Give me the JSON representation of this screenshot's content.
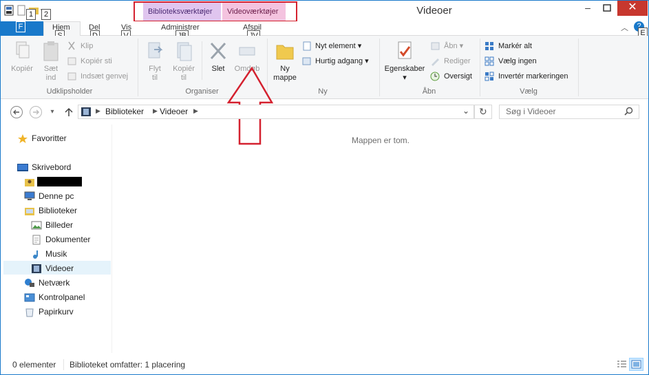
{
  "window": {
    "title": "Videoer"
  },
  "quick_access": {
    "keytip_1": "1",
    "keytip_2": "2"
  },
  "context_tabs": {
    "library_tools": "Biblioteksværktøjer",
    "video_tools": "Videoværktøjer"
  },
  "tabs": {
    "file_keytip": "F",
    "home": "Hjem",
    "home_keytip": "S",
    "share": "Del",
    "share_keytip": "D",
    "view": "Vis",
    "view_keytip": "V",
    "manage": "Administrer",
    "manage_keytip": "JB",
    "play": "Afspil",
    "play_keytip": "JV",
    "help_keytip": "E"
  },
  "ribbon": {
    "clipboard": {
      "label": "Udklipsholder",
      "copy": "Kopiér",
      "paste_1": "Sæt",
      "paste_2": "ind",
      "cut": "Klip",
      "copy_path": "Kopiér sti",
      "paste_shortcut": "Indsæt genvej"
    },
    "organize": {
      "label": "Organiser",
      "move_1": "Flyt",
      "move_2": "til",
      "copy_1": "Kopiér",
      "copy_2": "til",
      "delete": "Slet",
      "rename": "Omdøb"
    },
    "new": {
      "label": "Ny",
      "new_folder_1": "Ny",
      "new_folder_2": "mappe",
      "new_item": "Nyt element",
      "easy_access": "Hurtig adgang"
    },
    "open": {
      "label": "Åbn",
      "properties": "Egenskaber",
      "open": "Åbn",
      "edit": "Rediger",
      "history": "Oversigt"
    },
    "select": {
      "label": "Vælg",
      "select_all": "Markér alt",
      "select_none": "Vælg ingen",
      "invert": "Invertér markeringen"
    }
  },
  "address": {
    "crumb_1": "Biblioteker",
    "crumb_2": "Videoer",
    "search_placeholder": "Søg i Videoer"
  },
  "content": {
    "empty_message": "Mappen er tom."
  },
  "nav": {
    "favorites": "Favoritter",
    "desktop": "Skrivebord",
    "this_pc": "Denne pc",
    "libraries": "Biblioteker",
    "pictures": "Billeder",
    "documents": "Dokumenter",
    "music": "Musik",
    "videos": "Videoer",
    "network": "Netværk",
    "control_panel": "Kontrolpanel",
    "recycle_bin": "Papirkurv"
  },
  "status": {
    "item_count": "0 elementer",
    "library_info": "Biblioteket omfatter: 1 placering"
  },
  "colors": {
    "accent": "#1979ca",
    "annotation": "#d4212f",
    "library_tools": "#e0c5ef",
    "video_tools": "#f4c3df"
  }
}
